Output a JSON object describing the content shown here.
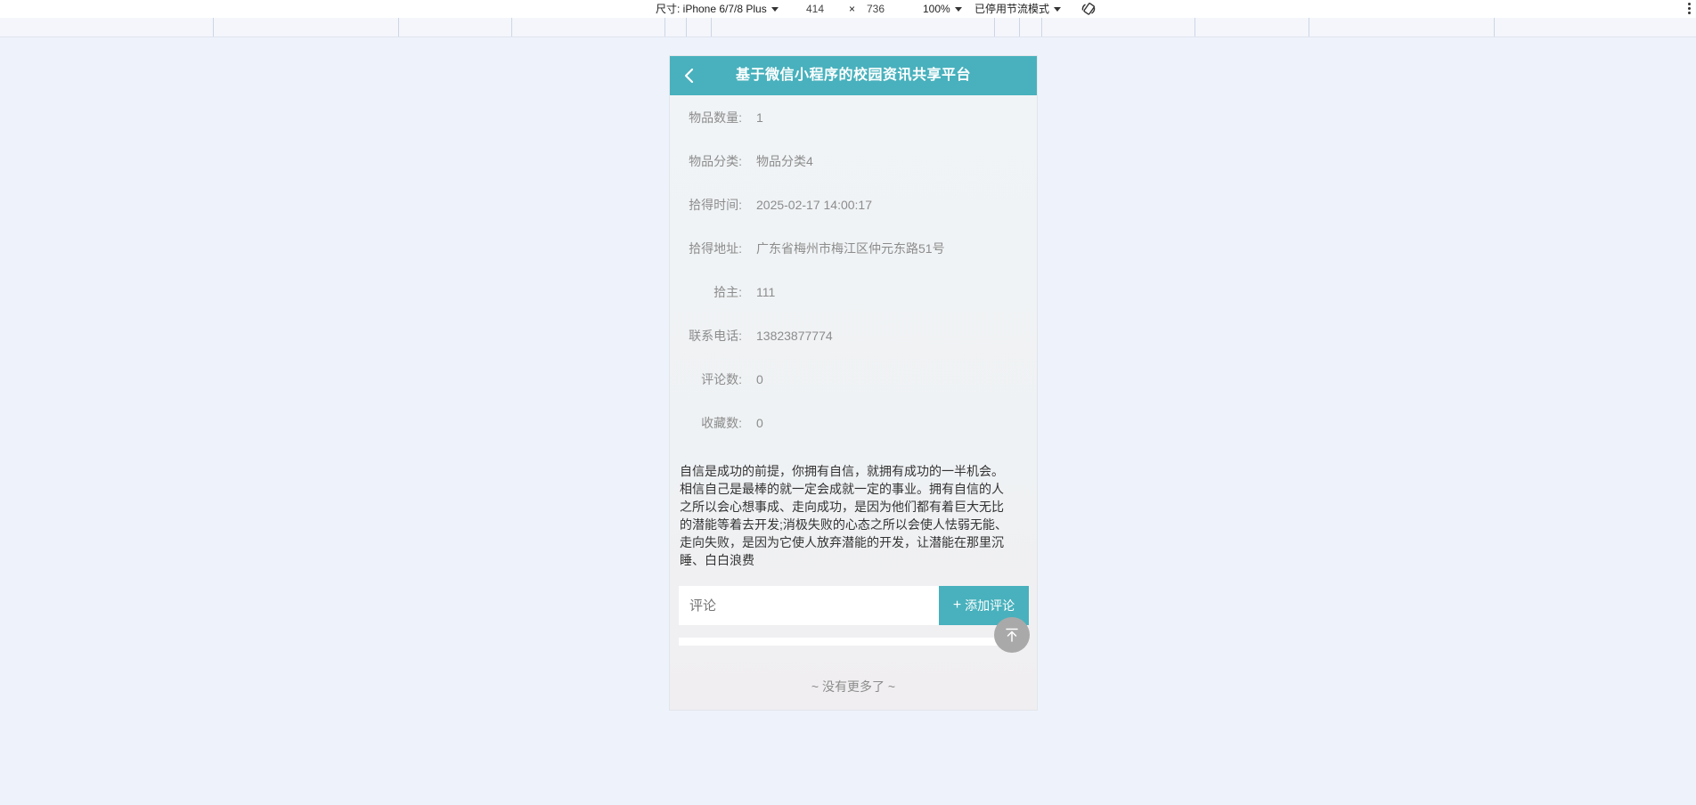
{
  "devtools": {
    "size_label": "尺寸: iPhone 6/7/8 Plus",
    "width": "414",
    "times": "×",
    "height": "736",
    "zoom": "100%",
    "throttle": "已停用节流模式"
  },
  "header": {
    "title": "基于微信小程序的校园资讯共享平台"
  },
  "fields": [
    {
      "label": "物品数量:",
      "value": "1"
    },
    {
      "label": "物品分类:",
      "value": "物品分类4"
    },
    {
      "label": "拾得时间:",
      "value": "2025-02-17 14:00:17"
    },
    {
      "label": "拾得地址:",
      "value": "广东省梅州市梅江区仲元东路51号"
    },
    {
      "label": "拾主:",
      "value": "111"
    },
    {
      "label": "联系电话:",
      "value": "13823877774"
    },
    {
      "label": "评论数:",
      "value": "0"
    },
    {
      "label": "收藏数:",
      "value": "0"
    }
  ],
  "description": "自信是成功的前提，你拥有自信，就拥有成功的一半机会。相信自己是最棒的就一定会成就一定的事业。拥有自信的人之所以会心想事成、走向成功，是因为他们都有着巨大无比的潜能等着去开发;消极失败的心态之所以会使人怯弱无能、走向失败，是因为它使人放弃潜能的开发，让潜能在那里沉睡、白白浪费",
  "comment": {
    "placeholder": "评论",
    "add_label": "添加评论",
    "plus": "+"
  },
  "footer": {
    "no_more": "~ 没有更多了 ~"
  },
  "icons": {
    "back": "chevron-left-icon",
    "to_top": "arrow-up-to-top-icon",
    "rotate": "rotate-icon",
    "more": "more-vertical-icon"
  },
  "colors": {
    "accent": "#48b1bd",
    "page_bg": "#eef2fb"
  }
}
